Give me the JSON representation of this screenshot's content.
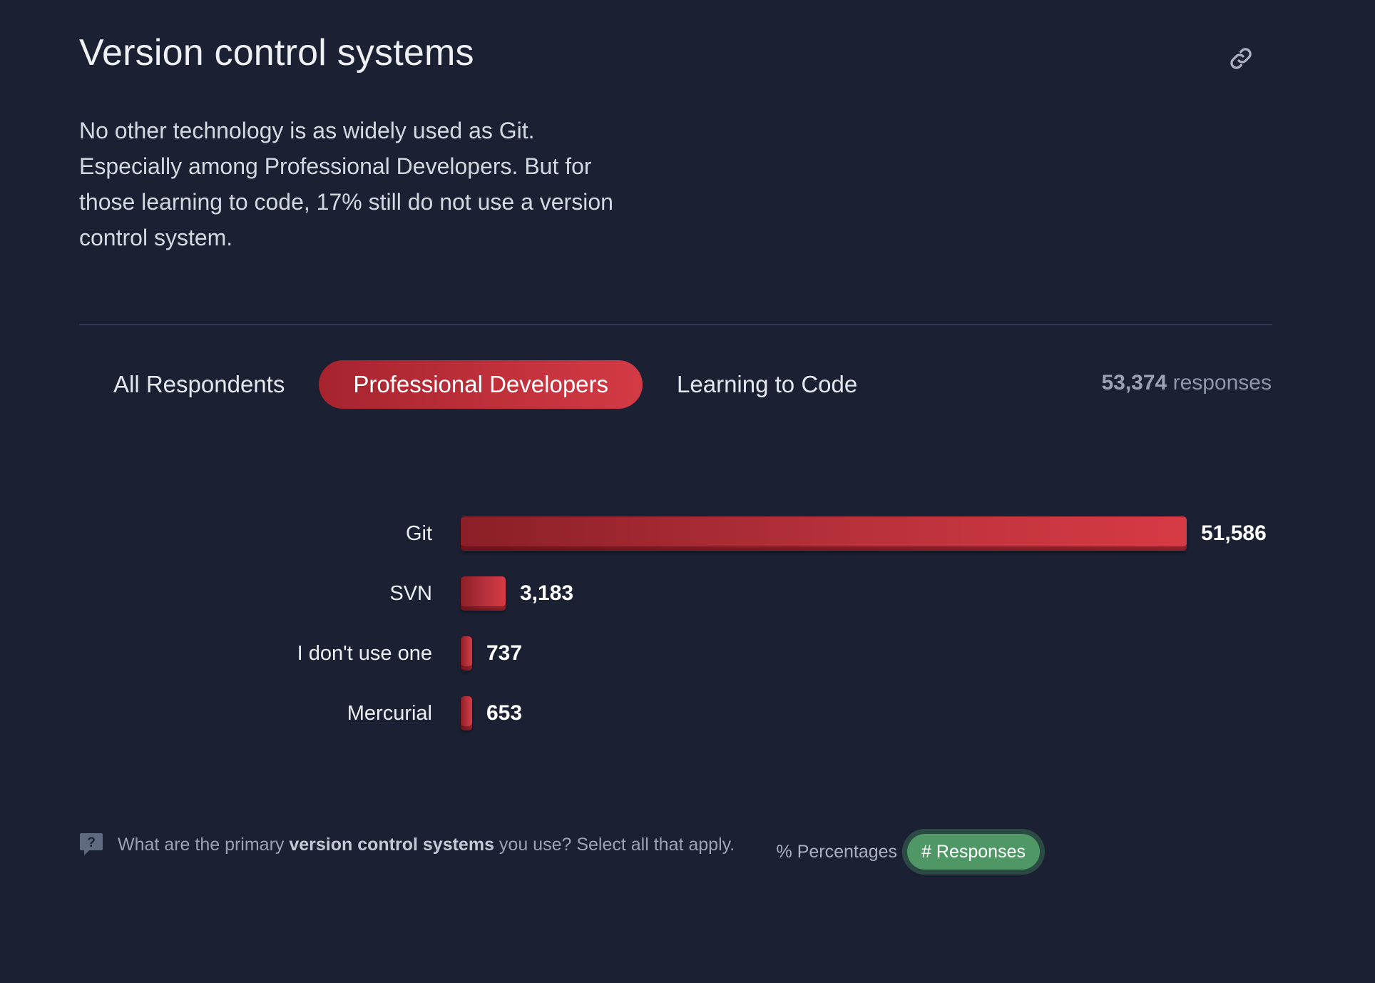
{
  "header": {
    "title": "Version control systems",
    "link_icon": "link-icon"
  },
  "description": "No other technology is as widely used as Git. Especially among Professional Developers. But for those learning to code, 17% still do not use a version control system.",
  "tabs": [
    {
      "label": "All Respondents",
      "active": false
    },
    {
      "label": "Professional Developers",
      "active": true
    },
    {
      "label": "Learning to Code",
      "active": false
    }
  ],
  "responses": {
    "count": "53,374",
    "suffix": "responses"
  },
  "chart_data": {
    "type": "bar",
    "orientation": "horizontal",
    "categories": [
      "Git",
      "SVN",
      "I don't use one",
      "Mercurial"
    ],
    "values": [
      51586,
      3183,
      737,
      653
    ],
    "value_labels": [
      "51,586",
      "3,183",
      "737",
      "653"
    ],
    "bar_color": "#d33a45"
  },
  "footer": {
    "question_icon": "question-icon",
    "question_prefix": "What are the primary ",
    "question_bold": "version control systems",
    "question_suffix": " you use? Select all that apply.",
    "toggle_percentages": "% Percentages",
    "toggle_responses": "# Responses",
    "active_toggle": "responses",
    "active_toggle_color": "#4f9866"
  }
}
